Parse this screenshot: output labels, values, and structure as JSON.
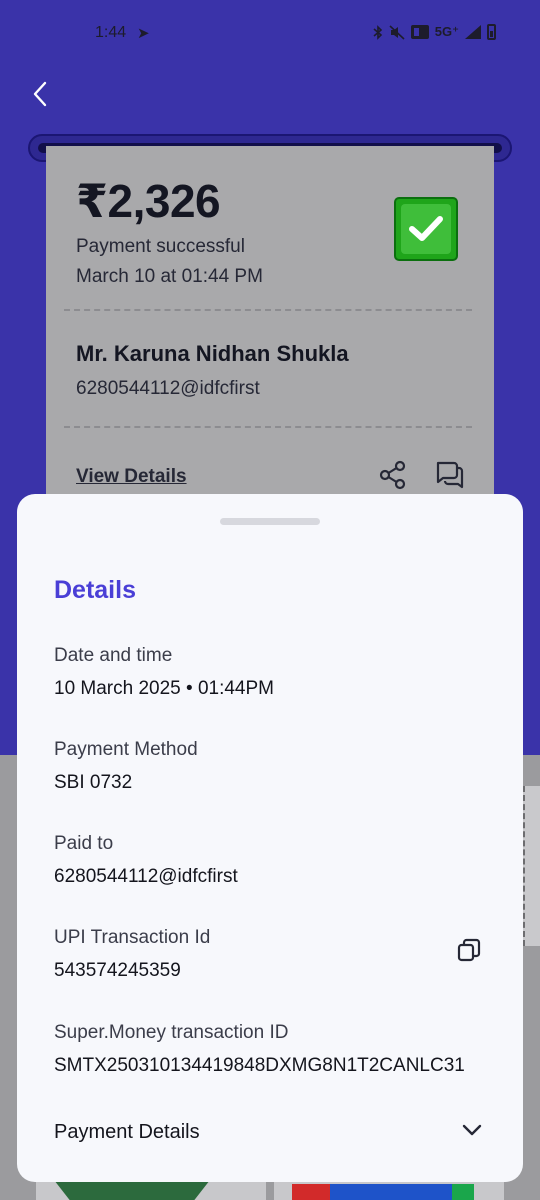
{
  "status_bar": {
    "time": "1:44",
    "nav_glyph": "➤",
    "network": "5G⁺"
  },
  "receipt": {
    "amount": "₹2,326",
    "status": "Payment successful",
    "datetime": "March 10 at 01:44 PM",
    "payee_name": "Mr. Karuna Nidhan Shukla",
    "payee_upi": "6280544112@idfcfirst",
    "view_details_label": "View Details",
    "success_icon": "check-icon",
    "share_icon": "share-icon",
    "chat_icon": "chat-icon"
  },
  "sheet": {
    "title": "Details",
    "fields": [
      {
        "label": "Date and time",
        "value": "10 March 2025 • 01:44PM"
      },
      {
        "label": "Payment Method",
        "value": "SBI 0732"
      },
      {
        "label": "Paid to",
        "value": "6280544112@idfcfirst"
      },
      {
        "label": "UPI Transaction Id",
        "value": "543574245359"
      },
      {
        "label": "Super.Money transaction ID",
        "value": "SMTX250310134419848DXMG8N1T2CANLC31"
      }
    ],
    "copy_icon": "copy-icon",
    "payment_details_label": "Payment Details",
    "expand_icon": "chevron-down-icon"
  },
  "colors": {
    "brand_purple": "#3a33a9",
    "accent_title": "#4a3fd6",
    "success_green": "#1fa51a"
  }
}
